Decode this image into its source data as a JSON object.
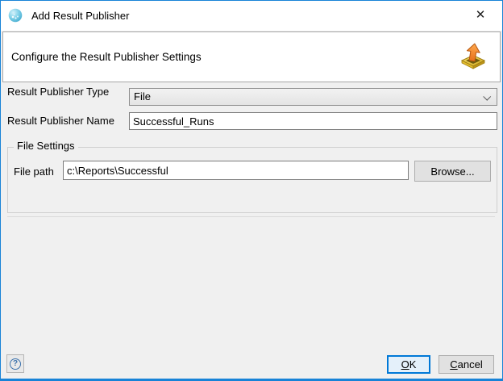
{
  "window": {
    "title": "Add Result Publisher",
    "close_glyph": "✕"
  },
  "banner": {
    "text": "Configure the Result Publisher Settings"
  },
  "form": {
    "type_label": "Result Publisher Type",
    "type_value": "File",
    "name_label": "Result Publisher Name",
    "name_value": "Successful_Runs",
    "group_title": "File Settings",
    "file_path_label": "File path",
    "file_path_value": "c:\\Reports\\Successful",
    "browse_label": "Browse..."
  },
  "footer": {
    "help_glyph": "?",
    "ok_label": "OK",
    "cancel_label": "Cancel"
  },
  "colors": {
    "accent": "#0078d7",
    "content_bg": "#f0f0f0",
    "banner_bg": "#ffffff",
    "button_bg": "#e1e1e1",
    "ok_bg": "#e4f0fa"
  }
}
